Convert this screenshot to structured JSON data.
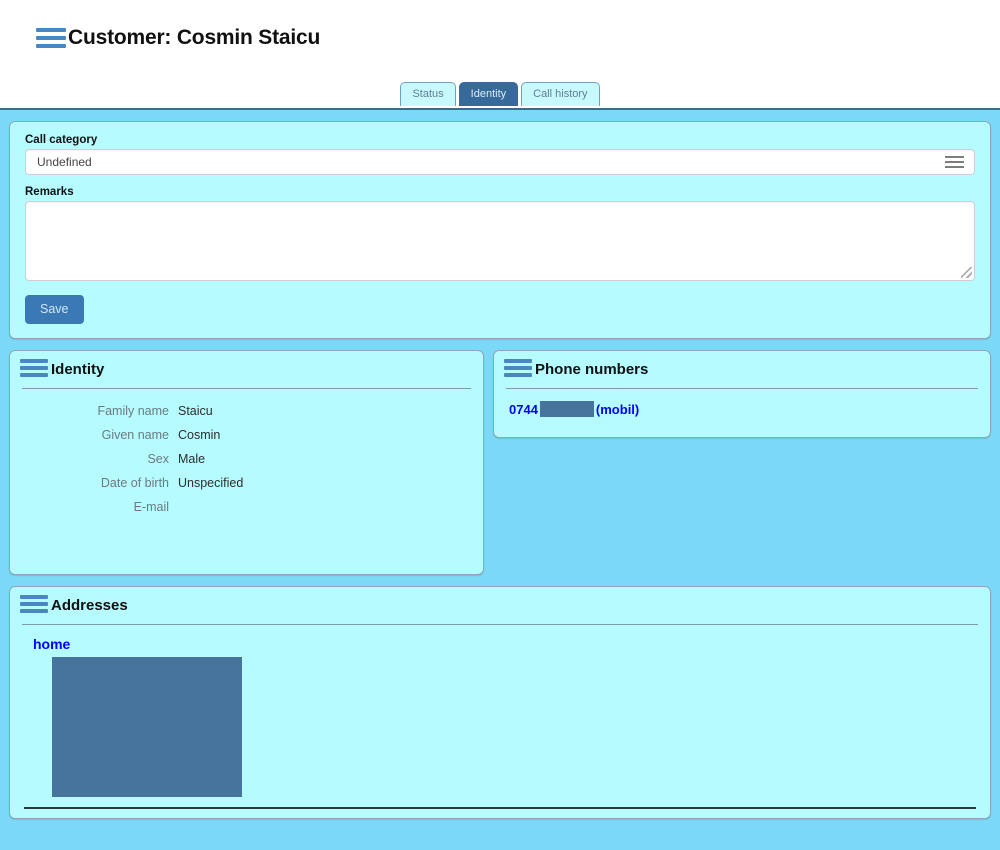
{
  "header": {
    "menu_icon": "hamburger-icon",
    "title": "Customer: Cosmin Staicu",
    "tabs": [
      {
        "label": "Status",
        "active": false
      },
      {
        "label": "Identity",
        "active": true
      },
      {
        "label": "Call history",
        "active": false
      }
    ]
  },
  "call_form": {
    "category_label": "Call category",
    "category_value": "Undefined",
    "category_dropdown_icon": "list-lines-icon",
    "remarks_label": "Remarks",
    "remarks_value": "",
    "remarks_placeholder": "",
    "resize_handle_icon": "resize-grip-icon",
    "save_label": "Save"
  },
  "identity": {
    "panel_icon": "hamburger-icon",
    "title": "Identity",
    "rows": [
      {
        "key": "Family name",
        "value": "Staicu"
      },
      {
        "key": "Given name",
        "value": "Cosmin"
      },
      {
        "key": "Sex",
        "value": "Male"
      },
      {
        "key": "Date of birth",
        "value": "Unspecified"
      },
      {
        "key": "E-mail",
        "value": ""
      }
    ]
  },
  "phones": {
    "panel_icon": "hamburger-icon",
    "title": "Phone numbers",
    "entries": [
      {
        "prefix": "0744",
        "redacted": true,
        "type": "(mobil)"
      }
    ]
  },
  "addresses": {
    "panel_icon": "hamburger-icon",
    "title": "Addresses",
    "entries": [
      {
        "kind": "home",
        "detail_redacted": true
      }
    ]
  },
  "colors": {
    "page_background": "#7bd9f7",
    "panel_background": "#b5fbff",
    "accent_blue": "#4a86c0",
    "active_tab": "#37699a",
    "link_blue": "#0000ff",
    "redaction": "#46749c",
    "save_button": "#3b79b4"
  }
}
